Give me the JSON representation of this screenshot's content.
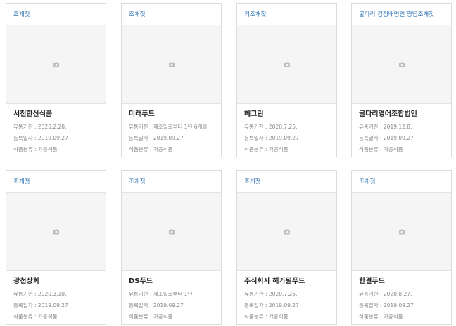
{
  "products": [
    {
      "tag": "조개젓",
      "name": "서천한산식품",
      "expiry": "유통기한 : 2020.2.20.",
      "registered": "등록일자 : 2019.09.27",
      "category": "식품분류 : 가공식품"
    },
    {
      "tag": "조개젓",
      "name": "미래푸드",
      "expiry": "유통기한 : 제조일로부터 1년 6개월",
      "registered": "등록일자 : 2019.09.27",
      "category": "식품분류 : 가공식품"
    },
    {
      "tag": "키조개젓",
      "name": "헤그린",
      "expiry": "유통기한 : 2020.7.25.",
      "registered": "등록일자 : 2019.09.27",
      "category": "식품분류 : 가공식품"
    },
    {
      "tag": "굴다리 김정배명인 양념조개젓",
      "name": "굴다리영어조합법인",
      "expiry": "유통기한 : 2019.12.8.",
      "registered": "등록일자 : 2019.09.27",
      "category": "식품분류 : 가공식품"
    },
    {
      "tag": "조개젓",
      "name": "광천상회",
      "expiry": "유통기한 : 2020.3.10.",
      "registered": "등록일자 : 2019.09.27",
      "category": "식품분류 : 가공식품"
    },
    {
      "tag": "조개젓",
      "name": "DS푸드",
      "expiry": "유통기한 : 제조일로부터 1년",
      "registered": "등록일자 : 2019.09.27",
      "category": "식품분류 : 가공식품"
    },
    {
      "tag": "조개젓",
      "name": "주식회사 해가원푸드",
      "expiry": "유통기한 : 2020.7.25.",
      "registered": "등록일자 : 2019.09.27",
      "category": "식품분류 : 가공식품"
    },
    {
      "tag": "조개젓",
      "name": "한결푸드",
      "expiry": "유통기한 : 2020.8.27.",
      "registered": "등록일자 : 2019.09.27",
      "category": "식품분류 : 가공식품"
    }
  ],
  "colors": {
    "tag": "#2a6fb0",
    "placeholder_bg": "#f5f5f5",
    "border": "#dcdcdc"
  },
  "icons": {
    "placeholder": "camera-icon"
  }
}
